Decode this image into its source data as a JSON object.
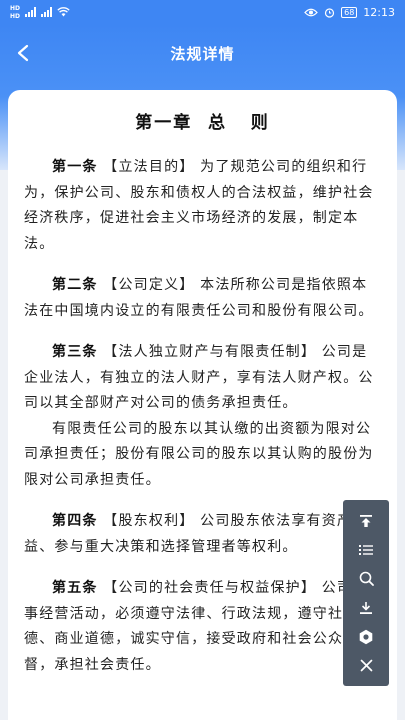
{
  "status_bar": {
    "sim1": "HD",
    "sim2": "HD",
    "network": "4G",
    "battery": "68",
    "time": "12:13"
  },
  "nav": {
    "title": "法规详情"
  },
  "content": {
    "chapter_title": "第一章  总   则",
    "articles": [
      {
        "num": "第一条",
        "tag": "【立法目的】",
        "paragraphs": [
          "为了规范公司的组织和行为，保护公司、股东和债权人的合法权益，维护社会经济秩序，促进社会主义市场经济的发展，制定本法。"
        ]
      },
      {
        "num": "第二条",
        "tag": "【公司定义】",
        "paragraphs": [
          "本法所称公司是指依照本法在中国境内设立的有限责任公司和股份有限公司。"
        ]
      },
      {
        "num": "第三条",
        "tag": "【法人独立财产与有限责任制】",
        "paragraphs": [
          "公司是企业法人，有独立的法人财产，享有法人财产权。公司以其全部财产对公司的债务承担责任。",
          "有限责任公司的股东以其认缴的出资额为限对公司承担责任；股份有限公司的股东以其认购的股份为限对公司承担责任。"
        ]
      },
      {
        "num": "第四条",
        "tag": "【股东权利】",
        "paragraphs": [
          "公司股东依法享有资产收益、参与重大决策和选择管理者等权利。"
        ]
      },
      {
        "num": "第五条",
        "tag": "【公司的社会责任与权益保护】",
        "paragraphs": [
          "公司从事经营活动，必须遵守法律、行政法规，遵守社会公德、商业道德，诚实守信，接受政府和社会公众的监督，承担社会责任。"
        ]
      }
    ]
  },
  "toolbar": {
    "items": [
      "scroll-to-top",
      "catalog",
      "search",
      "download",
      "settings",
      "close"
    ]
  },
  "colors": {
    "brand": "#3e86f3",
    "toolbar_bg": "#4d5866"
  }
}
